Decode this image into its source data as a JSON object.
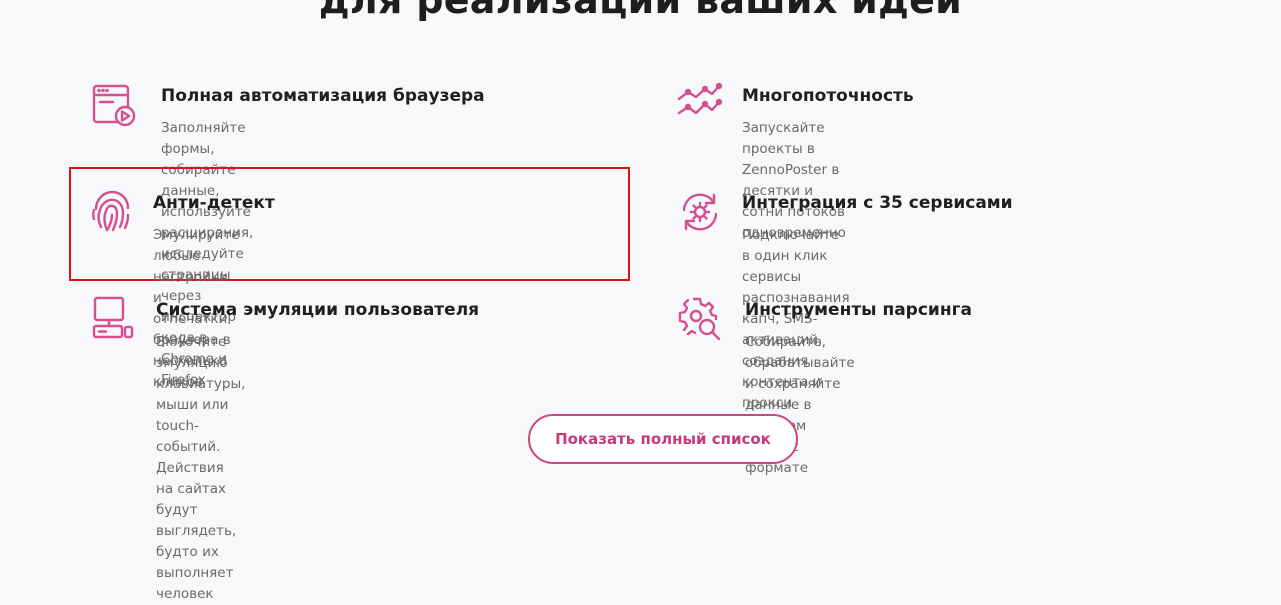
{
  "heading": "для реализации ваших идей",
  "accent_color": "#d5508f",
  "features": [
    {
      "icon": "browser-play-icon",
      "title": "Полная автоматизация браузера",
      "desc_line1": "Заполняйте формы, собирайте данные, используйте расширения,",
      "desc_line2": "исследуйте страницы через инспектор кода в Chrome и Firefox"
    },
    {
      "icon": "multithread-graph-icon",
      "title": "Многопоточность",
      "desc_line1": "Запускайте проекты в ZennoPoster в десятки и сотни потоков",
      "desc_line2": "одновременно"
    },
    {
      "icon": "fingerprint-icon",
      "title": "Анти-детект",
      "desc_line1": "Эмулируйте любые настройки и отпечатки браузера в несколько",
      "desc_line2": "кликов"
    },
    {
      "icon": "sync-gear-icon",
      "title": "Интеграция с 35 сервисами",
      "desc_line1": "Подключайте в один клик сервисы распознавания капч, SMS-",
      "desc_line2": "активаций, создания контента и прокси"
    },
    {
      "icon": "computer-icon",
      "title": "Система эмуляции пользователя",
      "desc_line1": "Включите эмуляцию клавиатуры, мыши или touch-событий. Действия",
      "desc_line2": "на сайтах будут выглядеть, будто их выполняет человек"
    },
    {
      "icon": "gear-search-icon",
      "title": "Инструменты парсинга",
      "desc_line1": "Собирайте, обрабатывайте и сохраняйте данные в удобном",
      "desc_line2": "для вас формате"
    }
  ],
  "cta_label": "Показать полный список"
}
